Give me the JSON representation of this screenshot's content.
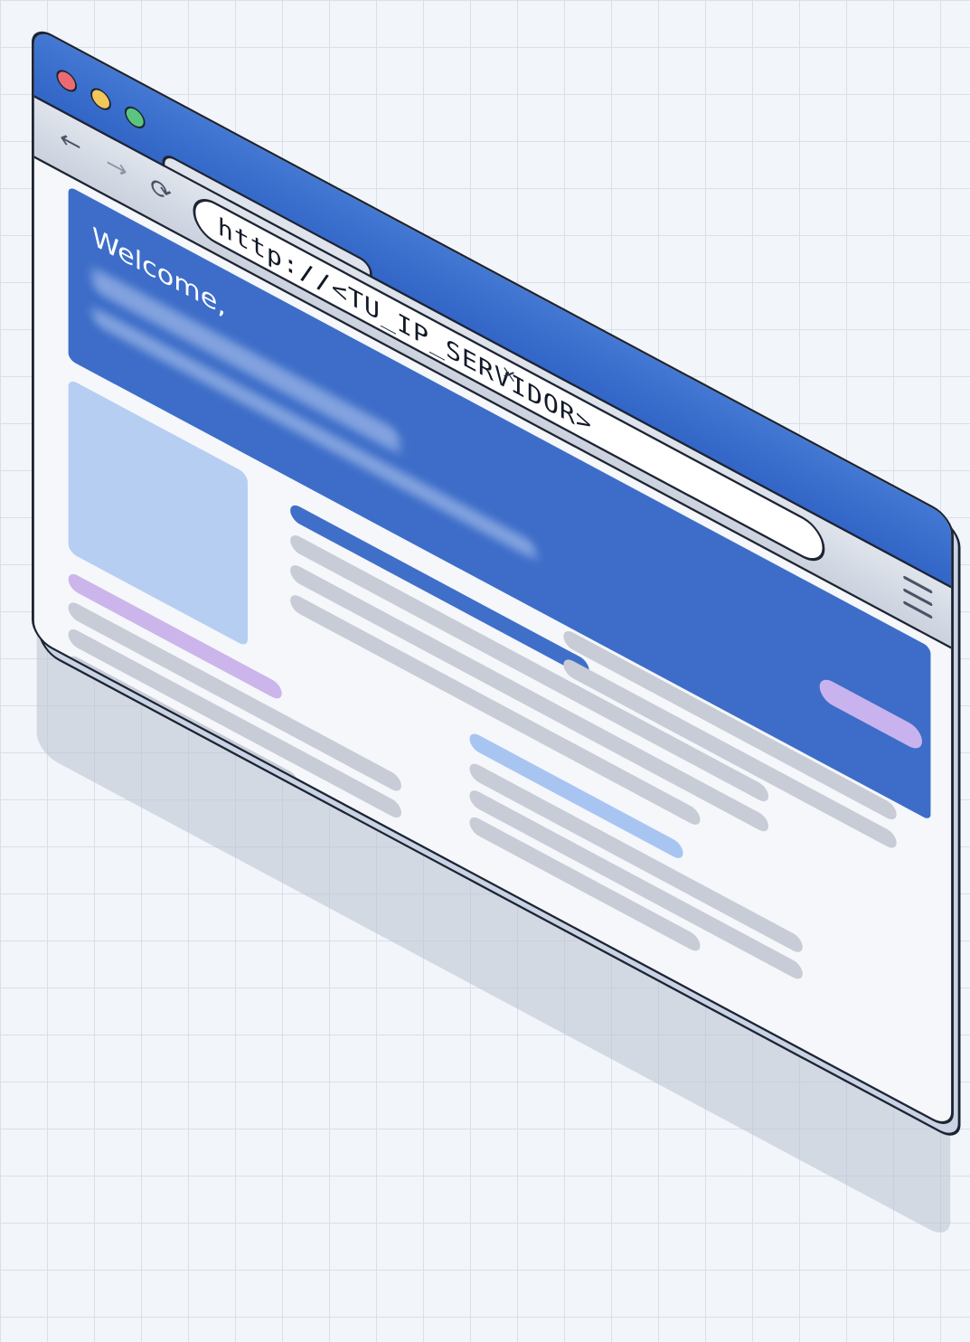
{
  "browser": {
    "url": "http://<TU_IP_SERVIDOR>",
    "tab_close_glyph": "×",
    "nav": {
      "back_glyph": "←",
      "forward_glyph": "→",
      "reload_glyph": "⟳"
    },
    "window_controls": [
      "close",
      "minimize",
      "maximize"
    ]
  },
  "page": {
    "welcome_text": "Welcome,"
  },
  "icons": {
    "menu": "hamburger-menu-icon",
    "back": "back-arrow-icon",
    "forward": "forward-arrow-icon",
    "reload": "reload-icon",
    "close_tab": "close-icon"
  },
  "colors": {
    "titlebar": "#3d6dc8",
    "hero": "#3d6dc8",
    "accent_purple": "#cbb5ea",
    "accent_lightblue": "#a8c5f2",
    "placeholder_gray": "#c7ccd6"
  }
}
